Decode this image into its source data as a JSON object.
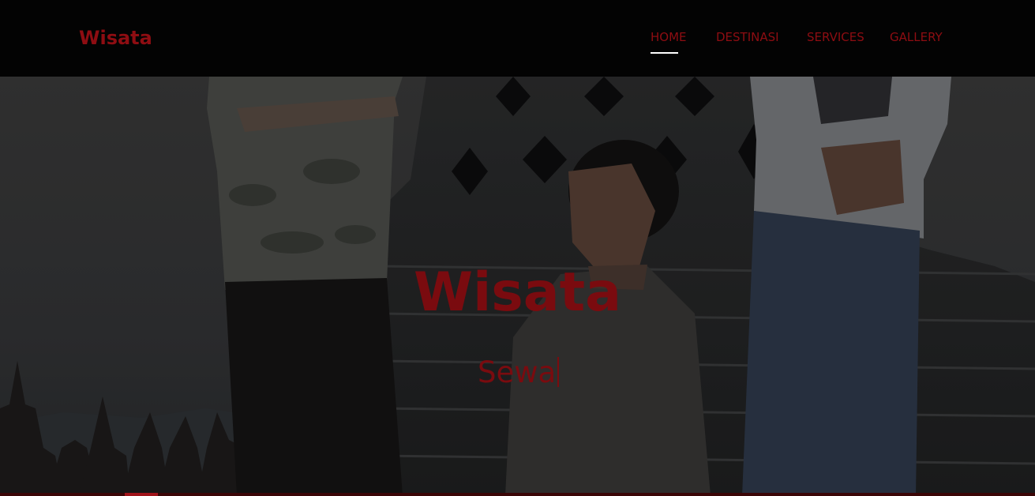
{
  "navbar": {
    "brand": "Wisata",
    "links": [
      {
        "label": "HOME",
        "active": true
      },
      {
        "label": "DESTINASI",
        "active": false
      },
      {
        "label": "SERVICES",
        "active": false
      },
      {
        "label": "GALLERY",
        "active": false
      }
    ]
  },
  "hero": {
    "title": "Wisata",
    "subtitle": "Sewa"
  },
  "colors": {
    "accent": "#8e0d12",
    "navbar_bg": "#030303",
    "active_underline": "#ffffff"
  }
}
